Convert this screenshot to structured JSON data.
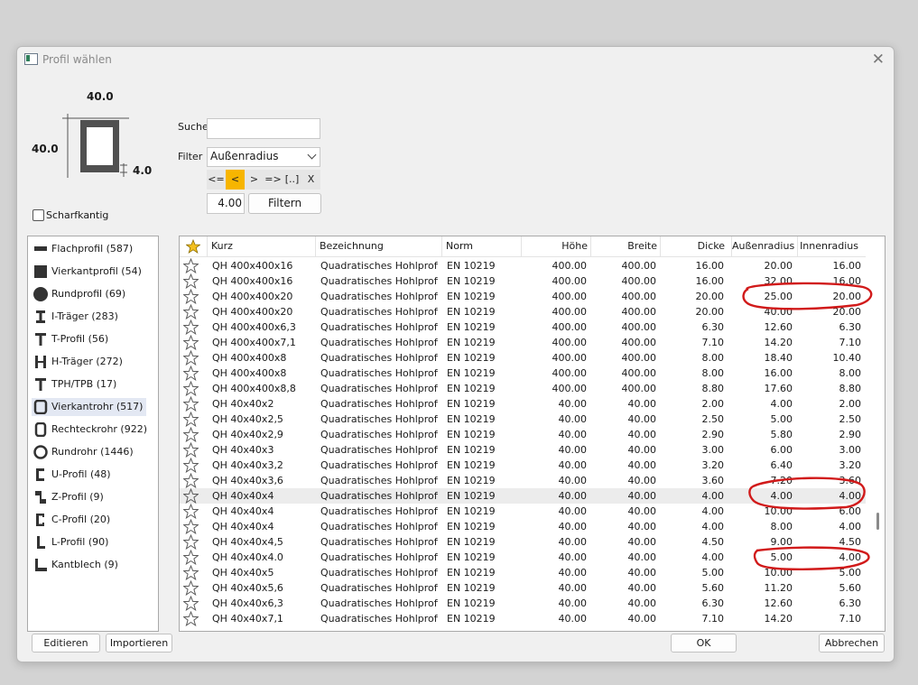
{
  "window": {
    "title": "Profil wählen",
    "close_icon": "close-icon"
  },
  "preview": {
    "width": "40.0",
    "height": "40.0",
    "thickness": "4.0"
  },
  "sharp_edge": {
    "label": "Scharfkantig",
    "checked": false
  },
  "search": {
    "label": "Suche",
    "value": ""
  },
  "filter": {
    "label": "Filter",
    "selected": "Außenradius",
    "operators": [
      "<=",
      "<",
      ">",
      "=>",
      "[..]",
      "X"
    ],
    "active_operator": "<",
    "value": "4.00",
    "apply_label": "Filtern",
    "accent": "#f7b500"
  },
  "categories": [
    {
      "label": "Flachprofil (587)",
      "icon": "flat-bar-icon"
    },
    {
      "label": "Vierkantprofil (54)",
      "icon": "square-bar-icon"
    },
    {
      "label": "Rundprofil (69)",
      "icon": "round-bar-icon"
    },
    {
      "label": "I-Träger (283)",
      "icon": "i-beam-icon"
    },
    {
      "label": "T-Profil (56)",
      "icon": "t-profile-icon"
    },
    {
      "label": "H-Träger (272)",
      "icon": "h-beam-icon"
    },
    {
      "label": "TPH/TPB (17)",
      "icon": "tph-profile-icon"
    },
    {
      "label": "Vierkantrohr (517)",
      "icon": "square-tube-icon",
      "selected": true
    },
    {
      "label": "Rechteckrohr (922)",
      "icon": "rectangular-tube-icon"
    },
    {
      "label": "Rundrohr (1446)",
      "icon": "round-tube-icon"
    },
    {
      "label": "U-Profil (48)",
      "icon": "u-profile-icon"
    },
    {
      "label": "Z-Profil (9)",
      "icon": "z-profile-icon"
    },
    {
      "label": "C-Profil (20)",
      "icon": "c-profile-icon"
    },
    {
      "label": "L-Profil (90)",
      "icon": "l-profile-icon"
    },
    {
      "label": "Kantblech (9)",
      "icon": "bent-sheet-icon"
    }
  ],
  "table": {
    "columns": [
      "Kurz",
      "Bezeichnung",
      "Norm",
      "Höhe",
      "Breite",
      "Dicke",
      "Außenradius",
      "Innenradius"
    ],
    "rows": [
      [
        "QH 400x400x16",
        "Quadratisches Hohlprofi...",
        "EN 10219",
        "400.00",
        "400.00",
        "16.00",
        "20.00",
        "16.00"
      ],
      [
        "QH 400x400x16",
        "Quadratisches Hohlprofi...",
        "EN 10219",
        "400.00",
        "400.00",
        "16.00",
        "32.00",
        "16.00"
      ],
      [
        "QH 400x400x20",
        "Quadratisches Hohlprofi...",
        "EN 10219",
        "400.00",
        "400.00",
        "20.00",
        "25.00",
        "20.00"
      ],
      [
        "QH 400x400x20",
        "Quadratisches Hohlprofi...",
        "EN 10219",
        "400.00",
        "400.00",
        "20.00",
        "40.00",
        "20.00"
      ],
      [
        "QH 400x400x6,3",
        "Quadratisches Hohlprofi...",
        "EN 10219",
        "400.00",
        "400.00",
        "6.30",
        "12.60",
        "6.30"
      ],
      [
        "QH 400x400x7,1",
        "Quadratisches Hohlprofi...",
        "EN 10219",
        "400.00",
        "400.00",
        "7.10",
        "14.20",
        "7.10"
      ],
      [
        "QH 400x400x8",
        "Quadratisches Hohlprofi...",
        "EN 10219",
        "400.00",
        "400.00",
        "8.00",
        "18.40",
        "10.40"
      ],
      [
        "QH 400x400x8",
        "Quadratisches Hohlprofi...",
        "EN 10219",
        "400.00",
        "400.00",
        "8.00",
        "16.00",
        "8.00"
      ],
      [
        "QH 400x400x8,8",
        "Quadratisches Hohlprofi...",
        "EN 10219",
        "400.00",
        "400.00",
        "8.80",
        "17.60",
        "8.80"
      ],
      [
        "QH 40x40x2",
        "Quadratisches Hohlprofi...",
        "EN 10219",
        "40.00",
        "40.00",
        "2.00",
        "4.00",
        "2.00"
      ],
      [
        "QH 40x40x2,5",
        "Quadratisches Hohlprofi...",
        "EN 10219",
        "40.00",
        "40.00",
        "2.50",
        "5.00",
        "2.50"
      ],
      [
        "QH 40x40x2,9",
        "Quadratisches Hohlprofi...",
        "EN 10219",
        "40.00",
        "40.00",
        "2.90",
        "5.80",
        "2.90"
      ],
      [
        "QH 40x40x3",
        "Quadratisches Hohlprofi...",
        "EN 10219",
        "40.00",
        "40.00",
        "3.00",
        "6.00",
        "3.00"
      ],
      [
        "QH 40x40x3,2",
        "Quadratisches Hohlprofi...",
        "EN 10219",
        "40.00",
        "40.00",
        "3.20",
        "6.40",
        "3.20"
      ],
      [
        "QH 40x40x3,6",
        "Quadratisches Hohlprofi...",
        "EN 10219",
        "40.00",
        "40.00",
        "3.60",
        "7.20",
        "3.60"
      ],
      [
        "QH 40x40x4",
        "Quadratisches Hohlprofi...",
        "EN 10219",
        "40.00",
        "40.00",
        "4.00",
        "4.00",
        "4.00"
      ],
      [
        "QH 40x40x4",
        "Quadratisches Hohlprofi...",
        "EN 10219",
        "40.00",
        "40.00",
        "4.00",
        "10.00",
        "6.00"
      ],
      [
        "QH 40x40x4",
        "Quadratisches Hohlprofi...",
        "EN 10219",
        "40.00",
        "40.00",
        "4.00",
        "8.00",
        "4.00"
      ],
      [
        "QH 40x40x4,5",
        "Quadratisches Hohlprofi...",
        "EN 10219",
        "40.00",
        "40.00",
        "4.50",
        "9.00",
        "4.50"
      ],
      [
        "QH 40x40x4.0",
        "Quadratisches Hohlprofi...",
        "EN 10219",
        "40.00",
        "40.00",
        "4.00",
        "5.00",
        "4.00"
      ],
      [
        "QH 40x40x5",
        "Quadratisches Hohlprofi...",
        "EN 10219",
        "40.00",
        "40.00",
        "5.00",
        "10.00",
        "5.00"
      ],
      [
        "QH 40x40x5,6",
        "Quadratisches Hohlprofi...",
        "EN 10219",
        "40.00",
        "40.00",
        "5.60",
        "11.20",
        "5.60"
      ],
      [
        "QH 40x40x6,3",
        "Quadratisches Hohlprofi...",
        "EN 10219",
        "40.00",
        "40.00",
        "6.30",
        "12.60",
        "6.30"
      ],
      [
        "QH 40x40x7,1",
        "Quadratisches Hohlprofi...",
        "EN 10219",
        "40.00",
        "40.00",
        "7.10",
        "14.20",
        "7.10"
      ]
    ],
    "highlighted_row": 15,
    "header_star_color": "#f4c01e"
  },
  "buttons": {
    "edit": "Editieren",
    "import": "Importieren",
    "ok": "OK",
    "cancel": "Abbrechen"
  },
  "annotation_color": "#d11a1a"
}
